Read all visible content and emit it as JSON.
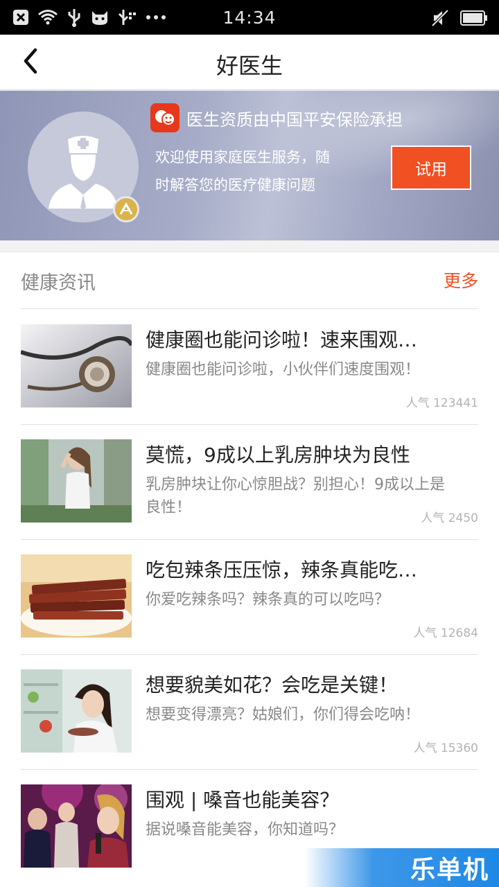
{
  "status_bar": {
    "time": "14:34",
    "left_icons": [
      "close-box-icon",
      "wifi-icon",
      "usb-icon",
      "android-cat-icon",
      "usb-debug-icon",
      "more-dots-icon"
    ],
    "right_icons": [
      "mute-icon",
      "battery-icon"
    ]
  },
  "navbar": {
    "title": "好医生",
    "back_icon": "chevron-left-icon"
  },
  "banner": {
    "insurance_text": "医生资质由中国平安保险承担",
    "description": "欢迎使用家庭医生服务，随时解答您的医疗健康问题",
    "try_label": "试用",
    "avatar_icon": "doctor-icon",
    "badge_icon": "chevron-up-badge-icon"
  },
  "news": {
    "title": "健康资讯",
    "more_label": "更多",
    "items": [
      {
        "title": "健康圈也能问诊啦！速来围观…",
        "desc": "健康圈也能问诊啦，小伙伴们速度围观！",
        "popularity": "人气 123441",
        "thumb": "stethoscope"
      },
      {
        "title": "莫慌，9成以上乳房肿块为良性",
        "desc": "乳房肿块让你心惊胆战？别担心！9成以上是良性！",
        "popularity": "人气 2450",
        "thumb": "woman-garden"
      },
      {
        "title": "吃包辣条压压惊，辣条真能吃…",
        "desc": "你爱吃辣条吗？辣条真的可以吃吗？",
        "popularity": "人气 12684",
        "thumb": "spicy-strips"
      },
      {
        "title": "想要貌美如花？会吃是关键！",
        "desc": "想要变得漂亮？姑娘们，你们得会吃呐！",
        "popularity": "人气 15360",
        "thumb": "woman-eating"
      },
      {
        "title": "围观 | 嗓音也能美容？",
        "desc": "据说嗓音能美容，你知道吗？",
        "popularity": "",
        "thumb": "singers"
      }
    ]
  },
  "watermark": "乐单机",
  "colors": {
    "accent": "#f05022",
    "banner": "#9aa0bd",
    "statusbar": "#000000"
  }
}
